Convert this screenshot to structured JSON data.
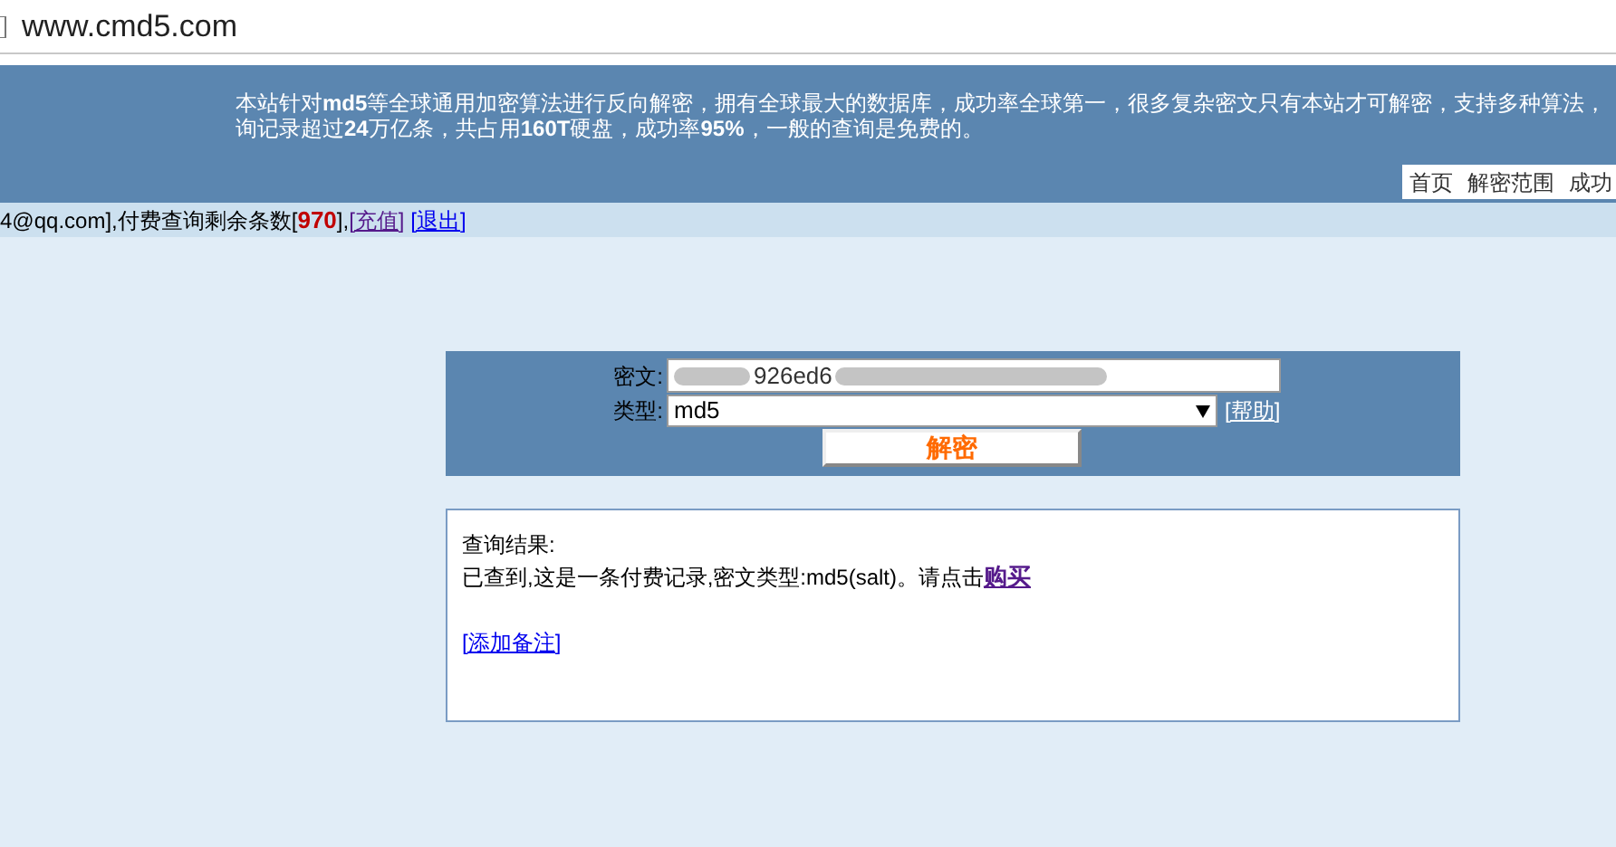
{
  "address_bar": {
    "url": "www.cmd5.com"
  },
  "header": {
    "lines": [
      "本站针对**md5**等全球通用加密算法进行反向解密，拥有全球最大的数据库，成功率全球第一，很多复杂密文只有本站才可解密，支持多种算法，",
      "询记录超过**24**万亿条，共占用**160T**硬盘，成功率**95%**，一般的查询是免费的。"
    ],
    "nav": [
      {
        "label": "首页"
      },
      {
        "label": "解密范围"
      },
      {
        "label": "成功"
      }
    ]
  },
  "user_bar": {
    "text": "4@qq.com],付费查询剩余条数[",
    "count": "970",
    "after": "],",
    "links": [
      {
        "label": "[充值]",
        "visited": true
      },
      {
        "label": "[退出]",
        "visited": false
      }
    ]
  },
  "form": {
    "cipher_label": "密文:",
    "cipher_value": "926ed6",
    "type_label": "类型:",
    "type_value": "md5",
    "help_link": "[帮助]",
    "submit": "解密"
  },
  "result": {
    "title": "查询结果:",
    "message": "已查到,这是一条付费记录,密文类型:md5(salt)。请点击",
    "buy_link": "购买",
    "note_link": "[添加备注]"
  }
}
